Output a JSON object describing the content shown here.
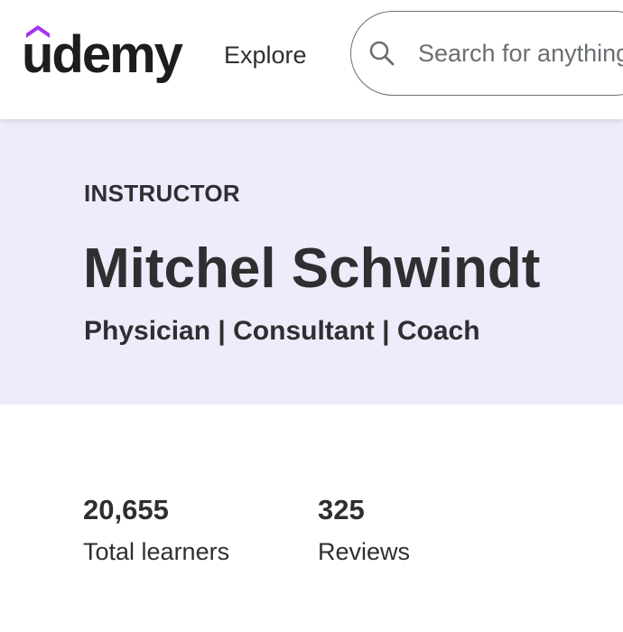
{
  "header": {
    "logo_text": "udemy",
    "brand_color": "#a435f0",
    "explore_label": "Explore",
    "search": {
      "placeholder": "Search for anything",
      "value": ""
    }
  },
  "hero": {
    "background": "#eeecfb",
    "eyebrow": "INSTRUCTOR",
    "name": "Mitchel Schwindt",
    "headline": "Physician | Consultant | Coach"
  },
  "stats": [
    {
      "value": "20,655",
      "label": "Total learners"
    },
    {
      "value": "325",
      "label": "Reviews"
    }
  ]
}
